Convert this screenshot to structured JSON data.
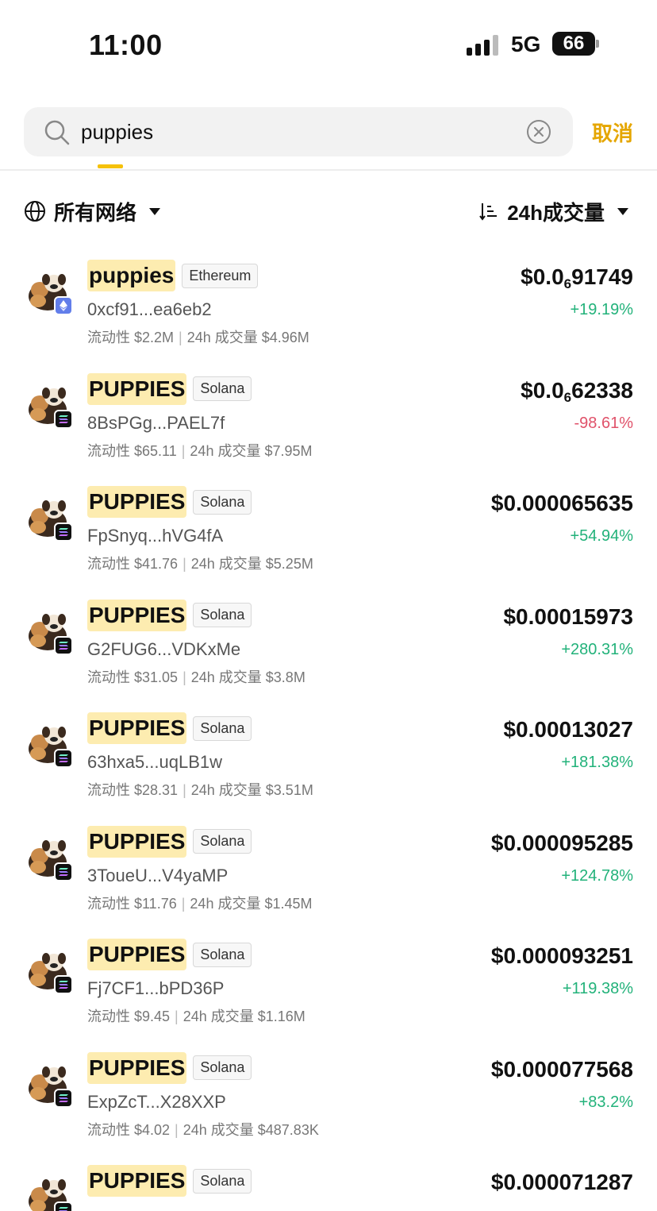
{
  "status": {
    "time": "11:00",
    "network": "5G",
    "battery": "66"
  },
  "search": {
    "query": "puppies",
    "cancel_label": "取消"
  },
  "filters": {
    "network_label": "所有网络",
    "sort_label": "24h成交量"
  },
  "colors": {
    "up": "#22b27a",
    "down": "#e0526a",
    "accent": "#e5a600",
    "highlight": "#fdecb0"
  },
  "tokens": [
    {
      "name": "puppies",
      "chain": "Ethereum",
      "chain_icon": "ethereum-icon",
      "address": "0xcf91...ea6eb2",
      "liquidity": "流动性 $2.2M",
      "volume": "24h 成交量 $4.96M",
      "price_prefix": "$0.0",
      "price_zeros": "6",
      "price_tail": "91749",
      "change": "+19.19%",
      "direction": "up"
    },
    {
      "name": "PUPPIES",
      "chain": "Solana",
      "chain_icon": "solana-icon",
      "address": "8BsPGg...PAEL7f",
      "liquidity": "流动性 $65.11",
      "volume": "24h 成交量 $7.95M",
      "price_prefix": "$0.0",
      "price_zeros": "6",
      "price_tail": "62338",
      "change": "-98.61%",
      "direction": "down"
    },
    {
      "name": "PUPPIES",
      "chain": "Solana",
      "chain_icon": "solana-icon",
      "address": "FpSnyq...hVG4fA",
      "liquidity": "流动性 $41.76",
      "volume": "24h 成交量 $5.25M",
      "price_prefix": "$0.000065635",
      "price_zeros": "",
      "price_tail": "",
      "change": "+54.94%",
      "direction": "up"
    },
    {
      "name": "PUPPIES",
      "chain": "Solana",
      "chain_icon": "solana-icon",
      "address": "G2FUG6...VDKxMe",
      "liquidity": "流动性 $31.05",
      "volume": "24h 成交量 $3.8M",
      "price_prefix": "$0.00015973",
      "price_zeros": "",
      "price_tail": "",
      "change": "+280.31%",
      "direction": "up"
    },
    {
      "name": "PUPPIES",
      "chain": "Solana",
      "chain_icon": "solana-icon",
      "address": "63hxa5...uqLB1w",
      "liquidity": "流动性 $28.31",
      "volume": "24h 成交量 $3.51M",
      "price_prefix": "$0.00013027",
      "price_zeros": "",
      "price_tail": "",
      "change": "+181.38%",
      "direction": "up"
    },
    {
      "name": "PUPPIES",
      "chain": "Solana",
      "chain_icon": "solana-icon",
      "address": "3ToueU...V4yaMP",
      "liquidity": "流动性 $11.76",
      "volume": "24h 成交量 $1.45M",
      "price_prefix": "$0.000095285",
      "price_zeros": "",
      "price_tail": "",
      "change": "+124.78%",
      "direction": "up"
    },
    {
      "name": "PUPPIES",
      "chain": "Solana",
      "chain_icon": "solana-icon",
      "address": "Fj7CF1...bPD36P",
      "liquidity": "流动性 $9.45",
      "volume": "24h 成交量 $1.16M",
      "price_prefix": "$0.000093251",
      "price_zeros": "",
      "price_tail": "",
      "change": "+119.38%",
      "direction": "up"
    },
    {
      "name": "PUPPIES",
      "chain": "Solana",
      "chain_icon": "solana-icon",
      "address": "ExpZcT...X28XXP",
      "liquidity": "流动性 $4.02",
      "volume": "24h 成交量 $487.83K",
      "price_prefix": "$0.000077568",
      "price_zeros": "",
      "price_tail": "",
      "change": "+83.2%",
      "direction": "up"
    },
    {
      "name": "PUPPIES",
      "chain": "Solana",
      "chain_icon": "solana-icon",
      "address": "",
      "liquidity": "",
      "volume": "",
      "price_prefix": "$0.000071287",
      "price_zeros": "",
      "price_tail": "",
      "change": "",
      "direction": "up"
    }
  ]
}
